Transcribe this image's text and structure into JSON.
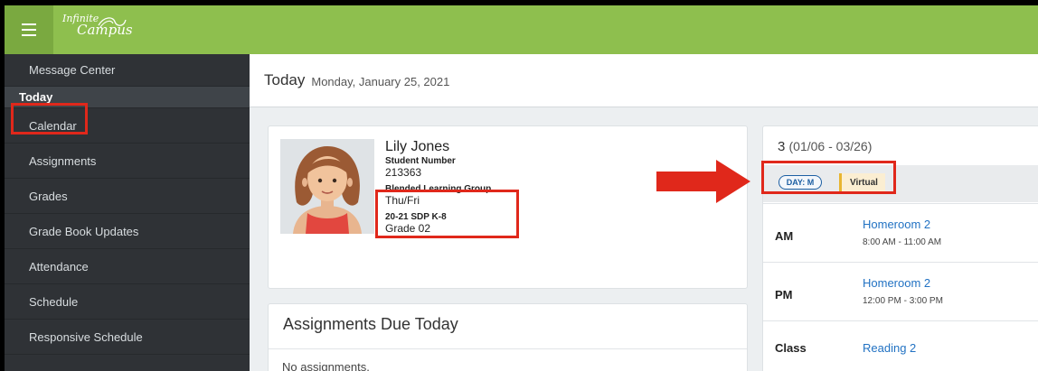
{
  "app": {
    "logo_line1": "Infinite",
    "logo_line2": "Campus",
    "brand_color": "#8ebf4e",
    "highlight_color": "#e0281b"
  },
  "sidebar": {
    "items": [
      {
        "label": "Message Center"
      },
      {
        "label": "Today",
        "active": true
      },
      {
        "label": "Calendar"
      },
      {
        "label": "Assignments"
      },
      {
        "label": "Grades"
      },
      {
        "label": "Grade Book Updates"
      },
      {
        "label": "Attendance"
      },
      {
        "label": "Schedule"
      },
      {
        "label": "Responsive Schedule"
      }
    ]
  },
  "header": {
    "title": "Today",
    "date": "Monday, January 25, 2021"
  },
  "student": {
    "name": "Lily Jones",
    "number_label": "Student Number",
    "number": "213363",
    "group_label": "Blended Learning Group",
    "group": "Thu/Fri",
    "school_label": "20-21 SDP K-8",
    "grade": "Grade 02"
  },
  "assignments": {
    "title": "Assignments Due Today",
    "empty_text": "No assignments."
  },
  "schedule": {
    "term": "3",
    "range": "(01/06 - 03/26)",
    "day_badge": "DAY: M",
    "mode_tag": "Virtual",
    "periods": [
      {
        "label": "AM",
        "course": "Homeroom 2",
        "time": "8:00 AM - 11:00 AM"
      },
      {
        "label": "PM",
        "course": "Homeroom 2",
        "time": "12:00 PM - 3:00 PM"
      },
      {
        "label": "Class",
        "course": "Reading 2",
        "time": ""
      }
    ]
  }
}
